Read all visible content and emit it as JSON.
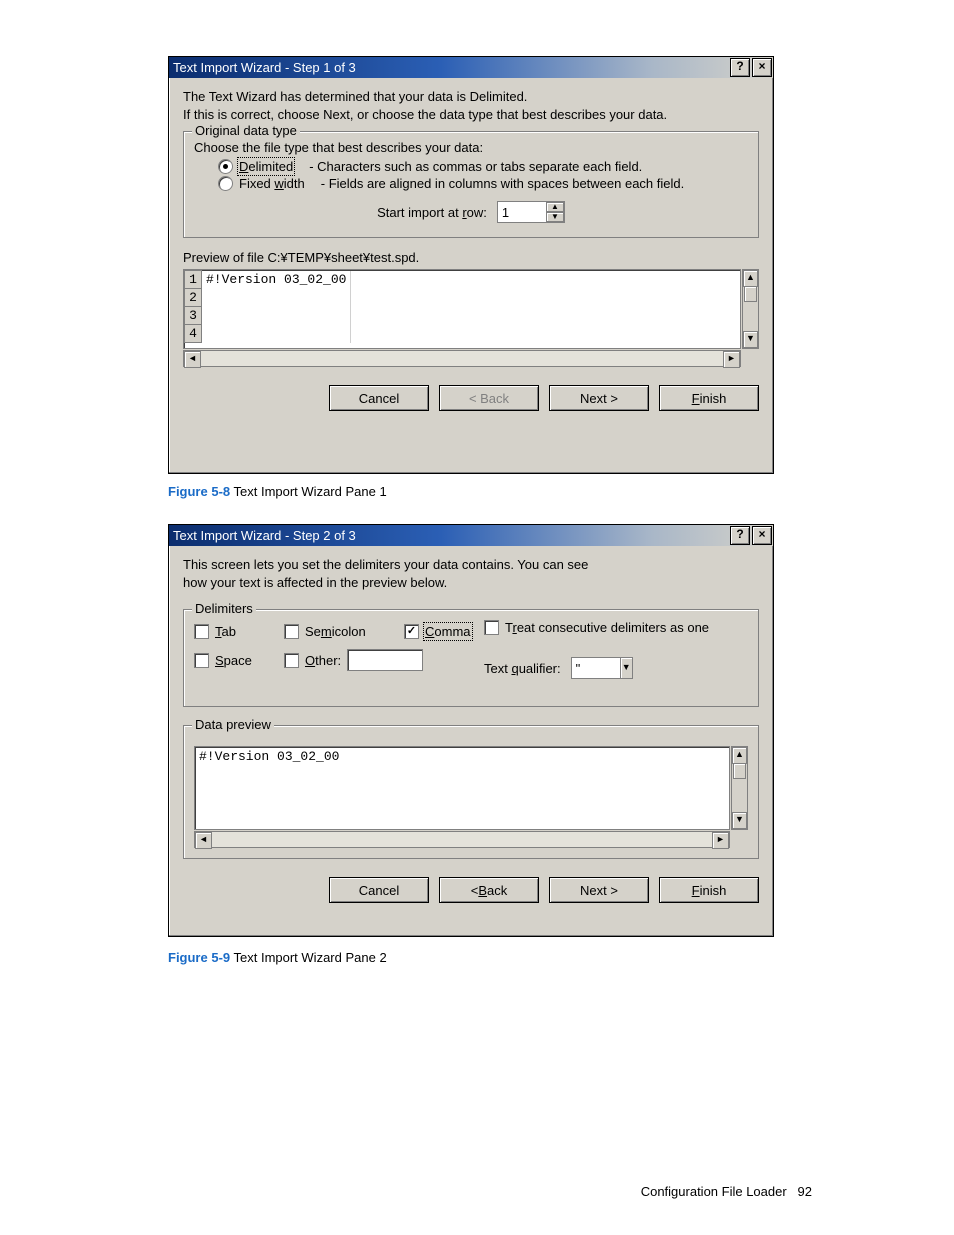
{
  "dialog1": {
    "title": "Text Import Wizard - Step 1 of 3",
    "help_glyph": "?",
    "close_glyph": "×",
    "intro_line1": "The Text Wizard has determined that your data is Delimited.",
    "intro_line2": "If this is correct, choose Next, or choose the data type that best describes your data.",
    "group_legend": "Original data type",
    "group_prompt": "Choose the file type that best describes your data:",
    "radio_delimited_label": "Delimited",
    "radio_delimited_desc": "- Characters such as commas or tabs separate each field.",
    "radio_fixed_label": "Fixed width",
    "radio_fixed_desc": "- Fields are aligned in columns with spaces between each field.",
    "start_row_label": "Start import at row:",
    "start_row_value": "1",
    "preview_label": "Preview of file C:¥TEMP¥sheet¥test.spd.",
    "preview_rows": [
      {
        "num": "1",
        "text": "#!Version 03_02_00"
      },
      {
        "num": "2",
        "text": ""
      },
      {
        "num": "3",
        "text": ""
      },
      {
        "num": "4",
        "text": ""
      }
    ],
    "buttons": {
      "cancel": "Cancel",
      "back": "< Back",
      "next": "Next >",
      "finish": "Finish"
    }
  },
  "caption1": {
    "fig": "Figure 5-8",
    "text": " Text Import Wizard Pane 1"
  },
  "dialog2": {
    "title": "Text Import Wizard - Step 2 of 3",
    "help_glyph": "?",
    "close_glyph": "×",
    "intro_line1": "This screen lets you set the delimiters your data contains.  You can see",
    "intro_line2": "how your text is affected in the preview below.",
    "delim_legend": "Delimiters",
    "opts": {
      "tab": "Tab",
      "semicolon": "Semicolon",
      "comma": "Comma",
      "space": "Space",
      "other": "Other:"
    },
    "treat_consecutive": "Treat consecutive delimiters as one",
    "text_qualifier_label": "Text qualifier:",
    "text_qualifier_value": "\"",
    "other_value": "",
    "data_preview_legend": "Data preview",
    "preview_text": "#!Version 03_02_00",
    "buttons": {
      "cancel": "Cancel",
      "back": "< Back",
      "next": "Next >",
      "finish": "Finish"
    }
  },
  "caption2": {
    "fig": "Figure 5-9",
    "text": " Text Import Wizard Pane 2"
  },
  "footer": {
    "section": "Configuration File Loader",
    "page": "92"
  }
}
